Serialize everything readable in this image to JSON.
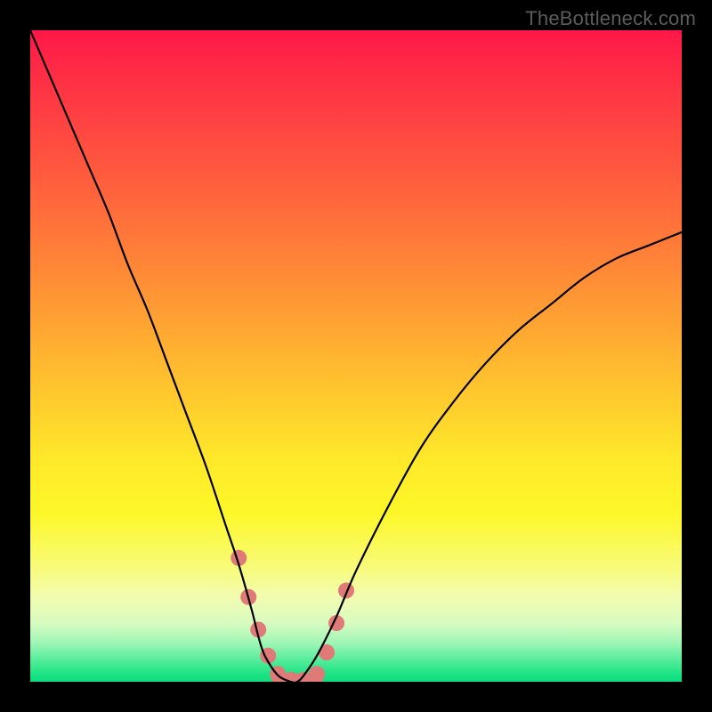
{
  "watermark": "TheBottleneck.com",
  "colors": {
    "frame": "#000000",
    "curve_stroke": "#000000",
    "marker_fill": "#e07a78",
    "watermark_text": "#5c5c5c"
  },
  "chart_data": {
    "type": "line",
    "title": "",
    "xlabel": "",
    "ylabel": "",
    "xlim": [
      0,
      100
    ],
    "ylim": [
      0,
      100
    ],
    "x": [
      0,
      3,
      6,
      9,
      12,
      15,
      18,
      21,
      24,
      27,
      30,
      32,
      34,
      35,
      36,
      38,
      40,
      41,
      42,
      44,
      47,
      50,
      55,
      60,
      65,
      70,
      75,
      80,
      85,
      90,
      95,
      100
    ],
    "y": [
      100,
      93,
      86,
      79,
      72,
      64,
      57,
      49,
      41,
      33,
      24,
      18,
      11,
      7,
      4,
      1,
      0,
      0,
      1,
      4,
      10,
      17,
      27,
      36,
      43,
      49,
      54,
      58,
      62,
      65,
      67,
      69
    ],
    "series": [
      {
        "name": "bottleneck-curve",
        "x": [
          0,
          3,
          6,
          9,
          12,
          15,
          18,
          21,
          24,
          27,
          30,
          32,
          34,
          35,
          36,
          38,
          40,
          41,
          42,
          44,
          47,
          50,
          55,
          60,
          65,
          70,
          75,
          80,
          85,
          90,
          95,
          100
        ],
        "y": [
          100,
          93,
          86,
          79,
          72,
          64,
          57,
          49,
          41,
          33,
          24,
          18,
          11,
          7,
          4,
          1,
          0,
          0,
          1,
          4,
          10,
          17,
          27,
          36,
          43,
          49,
          54,
          58,
          62,
          65,
          67,
          69
        ]
      }
    ],
    "markers": [
      {
        "x": 32.0,
        "y": 19
      },
      {
        "x": 33.5,
        "y": 13
      },
      {
        "x": 35.0,
        "y": 8
      },
      {
        "x": 36.5,
        "y": 4
      },
      {
        "x": 38.0,
        "y": 1.2
      },
      {
        "x": 40.0,
        "y": 0.3
      },
      {
        "x": 42.0,
        "y": 0.3
      },
      {
        "x": 44.0,
        "y": 1.2
      },
      {
        "x": 45.5,
        "y": 4.5
      },
      {
        "x": 47.0,
        "y": 9
      },
      {
        "x": 48.5,
        "y": 14
      }
    ],
    "baseline_segment": {
      "x0": 38,
      "x1": 44,
      "y": 0.3
    }
  }
}
